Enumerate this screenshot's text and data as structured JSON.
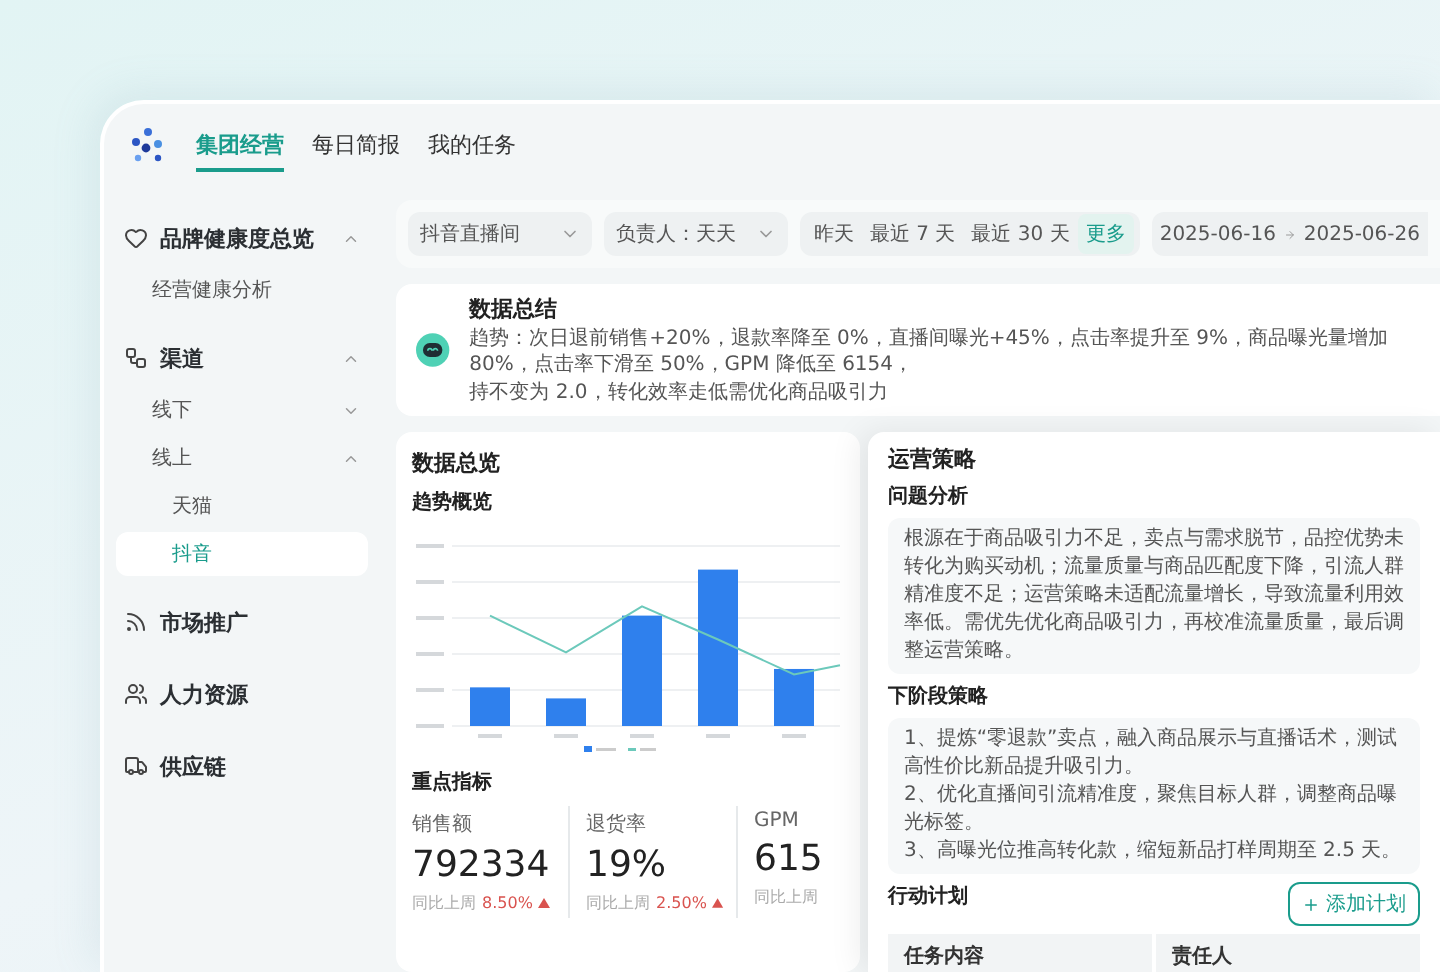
{
  "header": {
    "tabs": [
      {
        "label": "集团经营",
        "selected": true
      },
      {
        "label": "每日简报",
        "selected": false
      },
      {
        "label": "我的任务",
        "selected": false
      }
    ]
  },
  "sidebar": {
    "items": [
      {
        "label": "品牌健康度总览",
        "kind": "group",
        "expanded": true,
        "children": [
          {
            "label": "经营健康分析",
            "kind": "link",
            "selected": false
          }
        ]
      },
      {
        "label": "渠道",
        "kind": "group",
        "expanded": true,
        "children": [
          {
            "label": "线下",
            "kind": "group",
            "expanded": false
          },
          {
            "label": "线上",
            "kind": "group",
            "expanded": true,
            "children": [
              {
                "label": "天猫",
                "kind": "link",
                "selected": false
              },
              {
                "label": "抖音",
                "kind": "link",
                "selected": true
              }
            ]
          }
        ]
      },
      {
        "label": "市场推广",
        "kind": "link",
        "selected": false
      },
      {
        "label": "人力资源",
        "kind": "link",
        "selected": false
      },
      {
        "label": "供应链",
        "kind": "link",
        "selected": false
      }
    ]
  },
  "filters": {
    "channel": "抖音直播间",
    "owner": "负责人：天天",
    "ranges": [
      {
        "label": "昨天",
        "selected": false
      },
      {
        "label": "最近 7 天",
        "selected": false
      },
      {
        "label": "最近 30 天",
        "selected": false
      }
    ],
    "more": "更多",
    "date_start": "2025-06-16",
    "date_end": "2025-06-26"
  },
  "summary": {
    "title": "数据总结",
    "lines": [
      "趋势：次日退前销售+20%，退款率降至 0%，直播间曝光+45%，点击率提升至 9%，商品曝光量增加 80%，点击率下滑至 50%，GPM 降低至 6154，",
      "持不变为 2.0，转化效率走低需优化商品吸引力"
    ]
  },
  "overview": {
    "title": "数据总览",
    "trend_title": "趋势概览",
    "metrics_title": "重点指标",
    "metrics": [
      {
        "label": "销售额",
        "value": "792334",
        "compare_label": "同比上周",
        "change": "8.50%",
        "increased": true
      },
      {
        "label": "退货率",
        "value": "19%",
        "compare_label": "同比上周",
        "change": "2.50%",
        "increased": true
      },
      {
        "label": "GPM",
        "value": "615",
        "compare_label": "同比上周"
      }
    ]
  },
  "strategy": {
    "title": "运营策略",
    "analysis_title": "问题分析",
    "analysis_text": "根源在于商品吸引力不足，卖点与需求脱节，品控优势未转化为购买动机；流量质量与商品匹配度下降，引流人群精准度不足；运营策略未适配流量增长，导致流量利用效率低。需优先优化商品吸引力，再校准流量质量，最后调整运营策略。",
    "next_title": "下阶段策略",
    "next_items": [
      "1、提炼“零退款”卖点，融入商品展示与直播话术，测试高性价比新品提升吸引力。",
      "2、优化直播间引流精准度，聚焦目标人群，调整商品曝光标签。",
      "3、高曝光位推高转化款，缩短新品打样周期至 2.5 天。"
    ],
    "plan_title": "行动计划",
    "add_button": "添加计划",
    "columns": [
      "任务内容",
      "责任人"
    ]
  }
}
